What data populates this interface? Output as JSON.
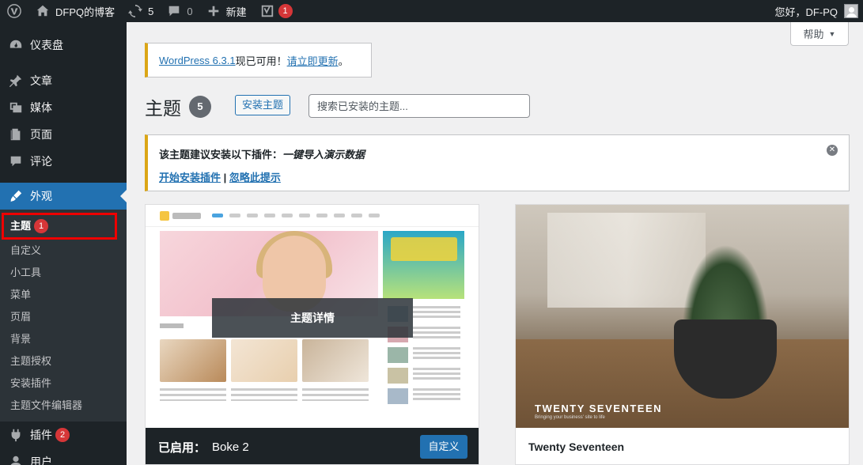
{
  "adminbar": {
    "site_name": "DFPQ的博客",
    "updates_count": "5",
    "comments_count": "0",
    "new_label": "新建",
    "yoast_badge": "1",
    "greeting": "您好，DF-PQ"
  },
  "sidebar": {
    "dashboard": "仪表盘",
    "posts": "文章",
    "media": "媒体",
    "pages": "页面",
    "comments": "评论",
    "appearance": "外观",
    "submenu": {
      "themes": "主题",
      "themes_badge": "1",
      "customize": "自定义",
      "widgets": "小工具",
      "menus": "菜单",
      "header": "页眉",
      "background": "背景",
      "theme_license": "主题授权",
      "install_plugins": "安装插件",
      "theme_editor": "主题文件编辑器"
    },
    "plugins": "插件",
    "plugins_badge": "2",
    "users": "用户"
  },
  "help_tab": "帮助",
  "update_nag": {
    "version_link": "WordPress 6.3.1",
    "text": "现已可用！",
    "update_link": "请立即更新",
    "end": "。"
  },
  "heading": {
    "title": "主题",
    "count": "5",
    "add_button": "安装主题",
    "search_placeholder": "搜索已安装的主题..."
  },
  "plugin_notice": {
    "text": "该主题建议安装以下插件：",
    "plugin": "一键导入演示数据",
    "begin_link": "开始安装插件",
    "separator": " | ",
    "dismiss_link": "忽略此提示"
  },
  "themes": [
    {
      "overlay": "主题详情",
      "active_label": "已启用：",
      "name": "Boke 2",
      "customize_button": "自定义"
    },
    {
      "name": "Twenty Seventeen",
      "screenshot_title": "TWENTY SEVENTEEN",
      "screenshot_sub": "Bringing your business' site to life"
    }
  ],
  "colors": {
    "admin_dark": "#1d2327",
    "accent_blue": "#2271b1",
    "badge_red": "#d63638",
    "notice_yellow": "#dba617",
    "highlight_red": "#ee0000"
  }
}
